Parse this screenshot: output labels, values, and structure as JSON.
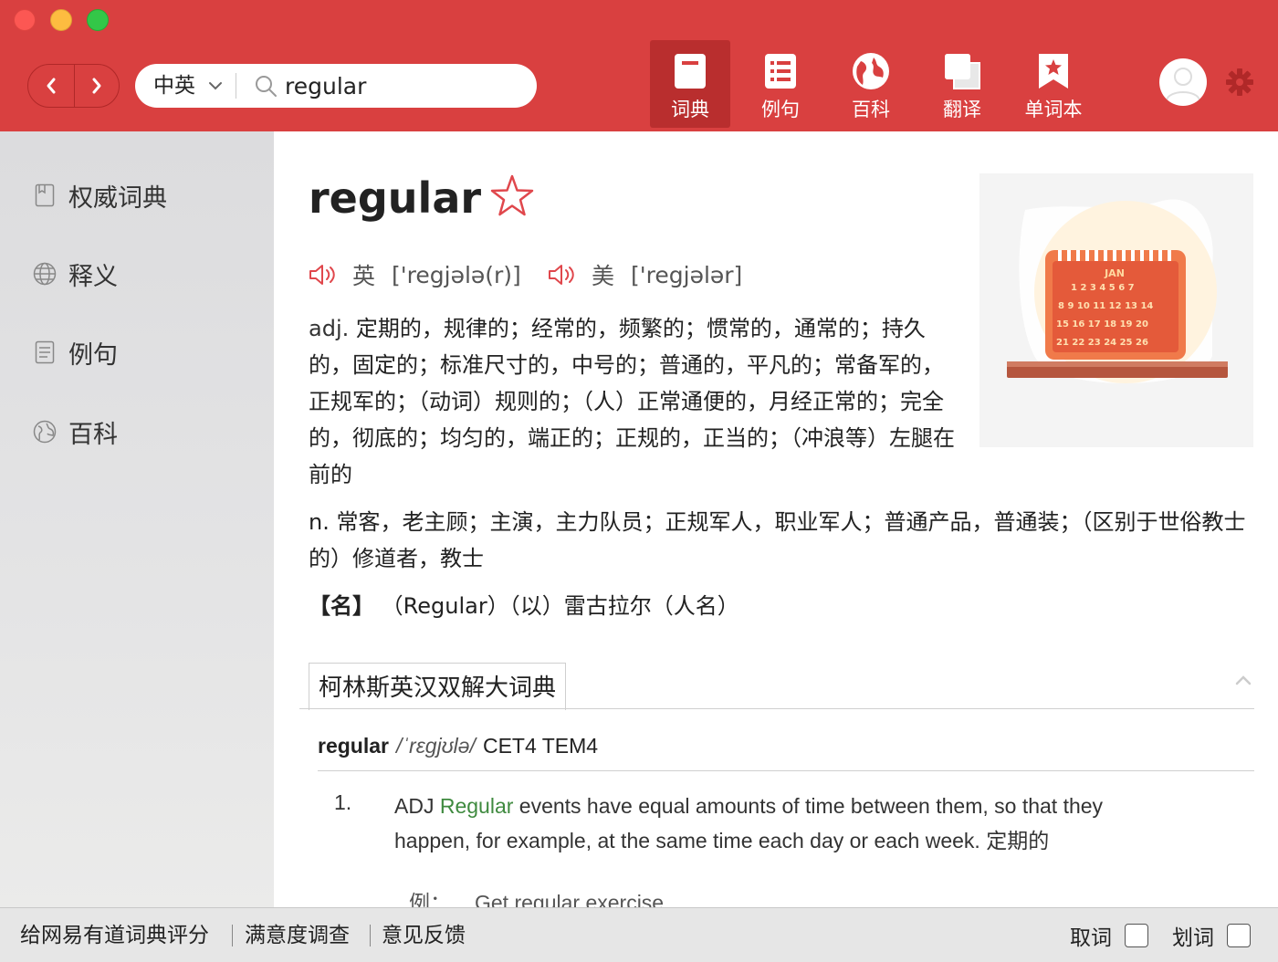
{
  "header": {
    "lang_select": "中英",
    "search_value": "regular",
    "toolbar": [
      {
        "label": "词典",
        "icon": "dictionary-icon",
        "active": true
      },
      {
        "label": "例句",
        "icon": "sentences-icon",
        "active": false
      },
      {
        "label": "百科",
        "icon": "encyclopedia-globe-icon",
        "active": false
      },
      {
        "label": "翻译",
        "icon": "translate-icon",
        "active": false
      },
      {
        "label": "单词本",
        "icon": "wordbook-icon",
        "active": false
      }
    ],
    "accent": "#d94040"
  },
  "sidebar": {
    "items": [
      {
        "label": "权威词典",
        "icon": "bookmark-icon"
      },
      {
        "label": "释义",
        "icon": "globe-icon"
      },
      {
        "label": "例句",
        "icon": "document-icon"
      },
      {
        "label": "百科",
        "icon": "encyclopedia-icon"
      }
    ]
  },
  "entry": {
    "word": "regular",
    "pron_uk_label": "英",
    "pron_uk": "['regjələ(r)]",
    "pron_us_label": "美",
    "pron_us": "['regjələr]",
    "adj_pos": "adj.",
    "adj_def": "定期的，规律的；经常的，频繁的；惯常的，通常的；持久的，固定的；标准尺寸的，中号的；普通的，平凡的；常备军的，正规军的；（动词）规则的；（人）正常通便的，月经正常的；完全的，彻底的；均匀的，端正的；正规的，正当的；（冲浪等）左腿在前的",
    "n_pos": "n.",
    "n_def": "常客，老主顾；主演，主力队员；正规军人，职业军人；普通产品，普通装；（区别于世俗教士的）修道者，教士",
    "name_label": "【名】",
    "name_def": "（Regular）（以）雷古拉尔（人名）",
    "picture_text": "JAN"
  },
  "collins": {
    "tab_label": "柯林斯英汉双解大词典",
    "headword": "regular",
    "phonetic": "/ˈrɛgjʊlə/",
    "levels": "CET4 TEM4",
    "sense_number": "1.",
    "sense_pos": "ADJ",
    "sense_keyword": "Regular",
    "sense_text": " events have equal amounts of time between them, so that they happen, for example, at the same time each day or each week. 定期的",
    "example_label": "例：",
    "example_text": "Get regular exercise."
  },
  "footer": {
    "link_rate": "给网易有道词典评分",
    "link_survey": "满意度调查",
    "link_feedback": "意见反馈",
    "check_word": "取词",
    "check_select": "划词"
  }
}
